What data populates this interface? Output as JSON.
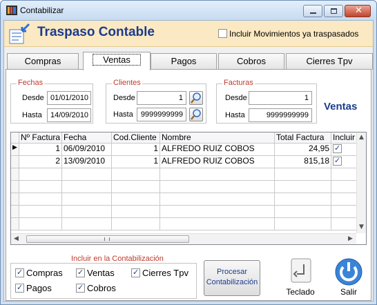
{
  "window": {
    "title": "Contabilizar"
  },
  "header": {
    "title": "Traspaso Contable",
    "include_moved_label": "Incluir Movimientos ya traspasados",
    "include_moved_checked": false
  },
  "tabs": [
    {
      "label": "Compras",
      "active": false
    },
    {
      "label": "Ventas",
      "active": true
    },
    {
      "label": "Pagos",
      "active": false
    },
    {
      "label": "Cobros",
      "active": false
    },
    {
      "label": "Cierres Tpv",
      "active": false
    }
  ],
  "filters": {
    "fechas": {
      "group_label": "Fechas",
      "desde_label": "Desde",
      "desde_value": "01/01/2010",
      "hasta_label": "Hasta",
      "hasta_value": "14/09/2010"
    },
    "clientes": {
      "group_label": "Clientes",
      "desde_label": "Desde",
      "desde_value": "1",
      "hasta_label": "Hasta",
      "hasta_value": "9999999999"
    },
    "facturas": {
      "group_label": "Facturas",
      "desde_label": "Desde",
      "desde_value": "1",
      "hasta_label": "Hasta",
      "hasta_value": "9999999999"
    }
  },
  "section_name": "Ventas",
  "grid": {
    "columns": [
      "Nº Factura",
      "Fecha",
      "Cod.Cliente",
      "Nombre",
      "Total Factura",
      "Incluir"
    ],
    "rows": [
      {
        "num": "1",
        "fecha": "06/09/2010",
        "cliente": "1",
        "nombre": "ALFREDO RUIZ COBOS",
        "total": "24,95",
        "incluir": true
      },
      {
        "num": "2",
        "fecha": "13/09/2010",
        "cliente": "1",
        "nombre": "ALFREDO RUIZ COBOS",
        "total": "815,18",
        "incluir": true
      }
    ]
  },
  "bottom": {
    "group_label": "Incluir en la Contabilización",
    "options": [
      {
        "label": "Compras",
        "checked": true
      },
      {
        "label": "Ventas",
        "checked": true
      },
      {
        "label": "Cierres Tpv",
        "checked": true
      },
      {
        "label": "Pagos",
        "checked": true
      },
      {
        "label": "Cobros",
        "checked": true
      }
    ],
    "process_button": "Procesar Contabilización",
    "keyboard_label": "Teclado",
    "exit_label": "Salir"
  }
}
